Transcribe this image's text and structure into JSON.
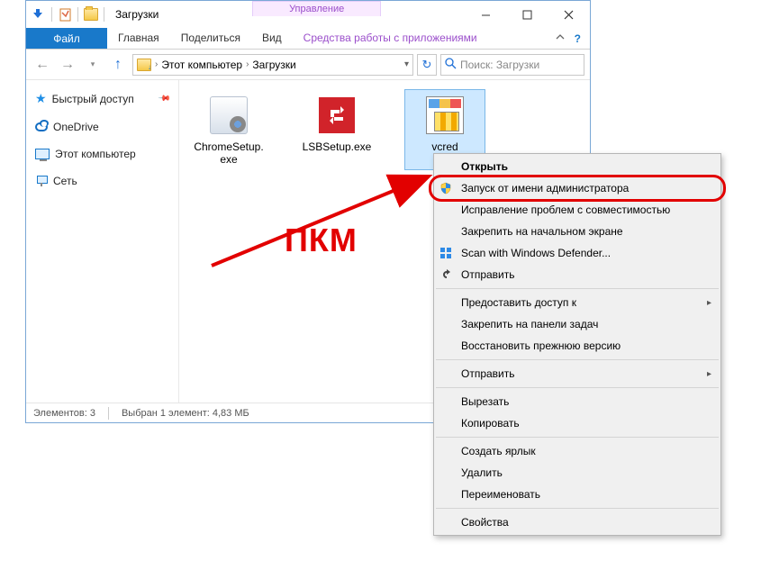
{
  "window": {
    "title": "Загрузки",
    "manage_tab": "Управление",
    "tabs": {
      "file": "Файл",
      "home": "Главная",
      "share": "Поделиться",
      "view": "Вид",
      "ctx": "Средства работы с приложениями"
    }
  },
  "address": {
    "root": "Этот компьютер",
    "folder": "Загрузки",
    "search_placeholder": "Поиск: Загрузки"
  },
  "sidebar": {
    "quick": "Быстрый доступ",
    "onedrive": "OneDrive",
    "pc": "Этот компьютер",
    "network": "Сеть"
  },
  "files": [
    {
      "name": "ChromeSetup.exe"
    },
    {
      "name": "LSBSetup.exe"
    },
    {
      "name": "vcred"
    }
  ],
  "status": {
    "count": "Элементов: 3",
    "selected": "Выбран 1 элемент: 4,83 МБ"
  },
  "ctxmenu": {
    "open": "Открыть",
    "run_admin": "Запуск от имени администратора",
    "compat": "Исправление проблем с совместимостью",
    "pin_start": "Закрепить на начальном экране",
    "defender": "Scan with Windows Defender...",
    "share": "Отправить",
    "grant_access": "Предоставить доступ к",
    "pin_taskbar": "Закрепить на панели задач",
    "restore": "Восстановить прежнюю версию",
    "send_to": "Отправить",
    "cut": "Вырезать",
    "copy": "Копировать",
    "shortcut": "Создать ярлык",
    "delete": "Удалить",
    "rename": "Переименовать",
    "properties": "Свойства"
  },
  "annotation": {
    "label": "ПКМ"
  }
}
